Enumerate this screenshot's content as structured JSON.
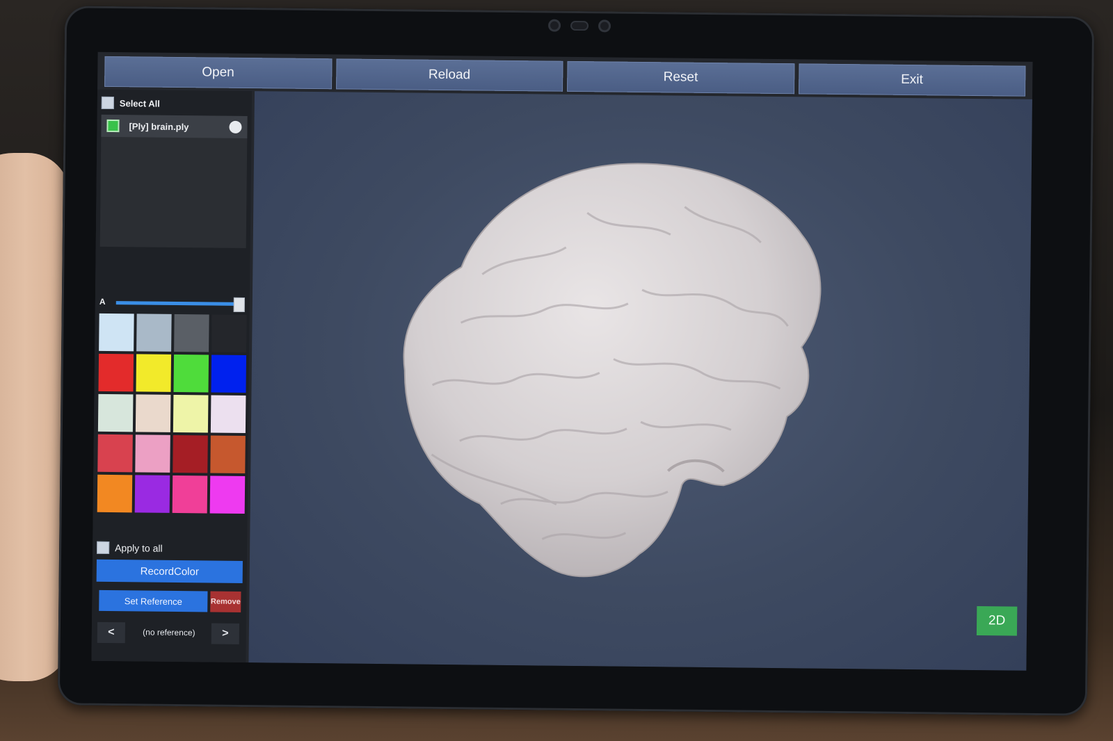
{
  "toolbar": {
    "buttons": [
      "Open",
      "Reload",
      "Reset",
      "Exit"
    ]
  },
  "sidebar": {
    "select_all_label": "Select All",
    "files": [
      {
        "label": "[Ply] brain.ply",
        "checked": true
      }
    ],
    "alpha_slider": {
      "label": "A",
      "value": 0.98
    },
    "palette": [
      "#cfe4f4",
      "#a9b9c8",
      "#5a5f66",
      "#24262b",
      "#e32b2b",
      "#f2ea2a",
      "#4fdc3b",
      "#0021ee",
      "#d7e6dc",
      "#ead9cc",
      "#eef4a8",
      "#ece0ef",
      "#d8424f",
      "#eca0c4",
      "#a51e25",
      "#c6582e",
      "#f28822",
      "#9a2ae2",
      "#f03f98",
      "#ee3af0"
    ],
    "apply_to_all_label": "Apply to all",
    "record_color_label": "RecordColor",
    "set_reference_label": "Set Reference",
    "remove_label": "Remove",
    "prev_label": "<",
    "next_label": ">",
    "reference_text": "(no reference)"
  },
  "viewport": {
    "mode_button_label": "2D",
    "model_icon": "brain-model-icon"
  }
}
